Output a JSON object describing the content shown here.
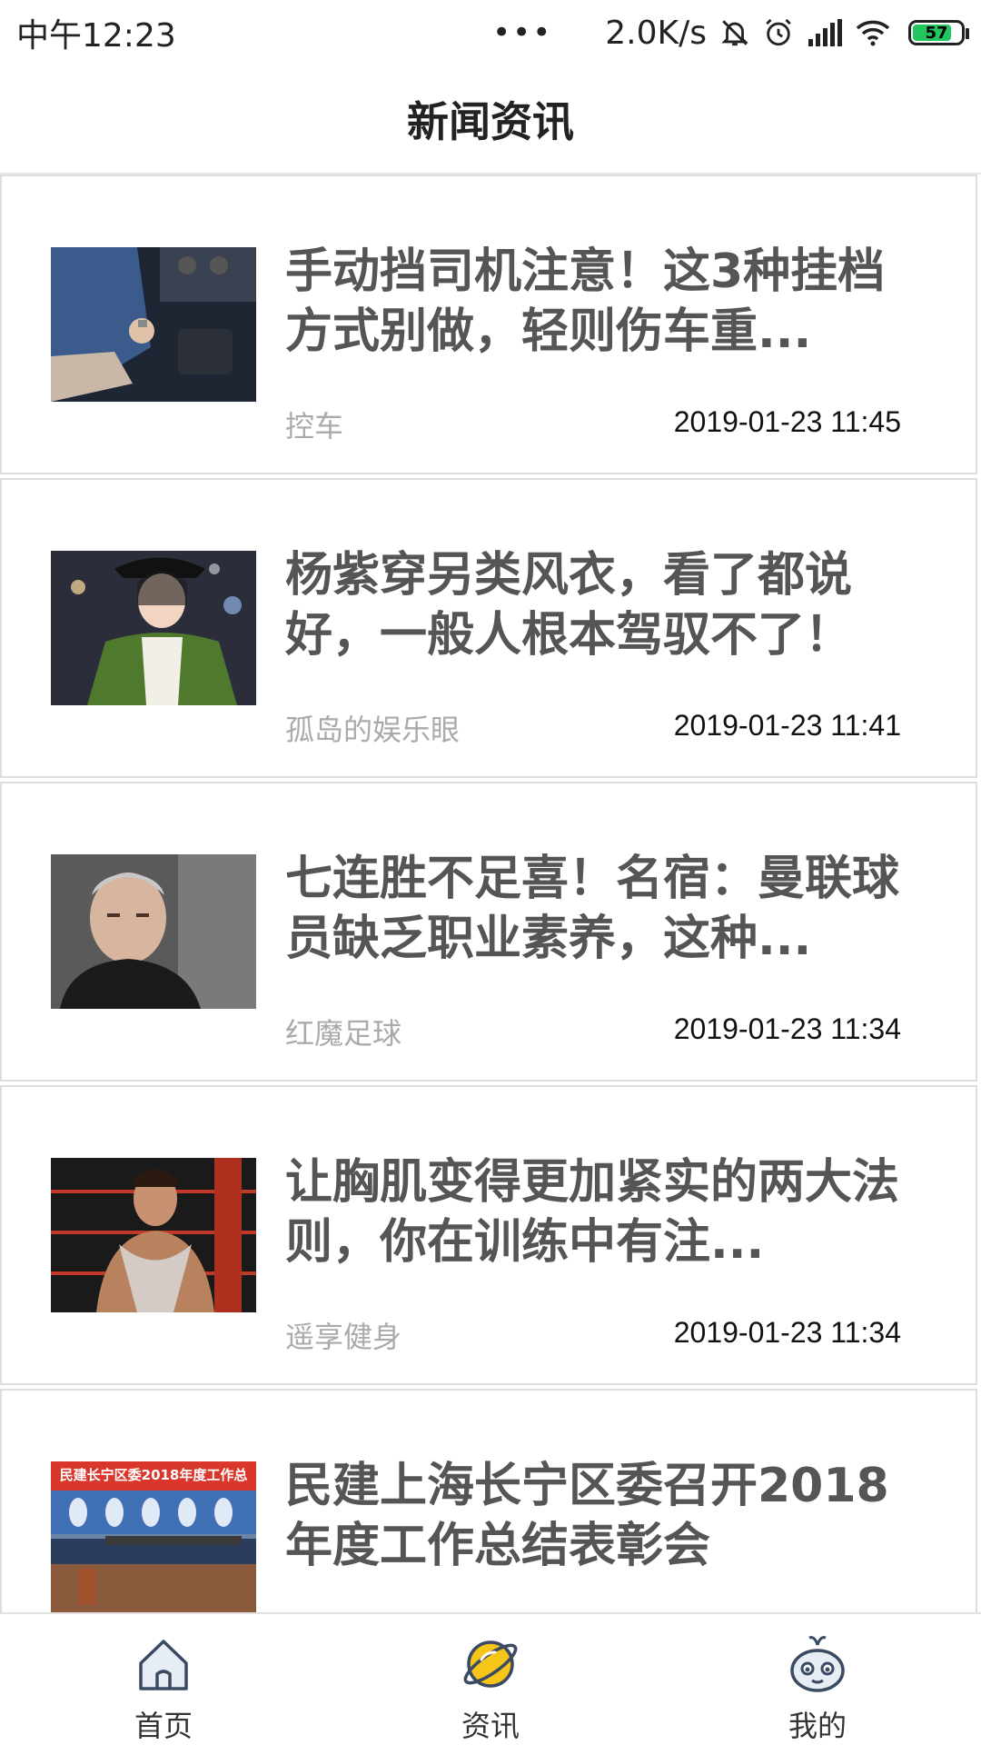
{
  "status_bar": {
    "time": "中午12:23",
    "dots": "•••",
    "speed": "2.0K/s",
    "battery": "57",
    "icons": [
      "bell-muted-icon",
      "alarm-icon",
      "signal-icon",
      "wifi-icon",
      "battery-icon"
    ]
  },
  "header": {
    "title": "新闻资讯"
  },
  "news": [
    {
      "title": "手动挡司机注意！这3种挂档方式别做，轻则伤车重...",
      "source": "控车",
      "time": "2019-01-23 11:45"
    },
    {
      "title": "杨紫穿另类风衣，看了都说好，一般人根本驾驭不了！",
      "source": "孤岛的娱乐眼",
      "time": "2019-01-23 11:41"
    },
    {
      "title": "七连胜不足喜！名宿：曼联球员缺乏职业素养，这种...",
      "source": "红魔足球",
      "time": "2019-01-23 11:34"
    },
    {
      "title": "让胸肌变得更加紧实的两大法则，你在训练中有注...",
      "source": "遥享健身",
      "time": "2019-01-23 11:34"
    },
    {
      "title": "民建上海长宁区委召开2018年度工作总结表彰会",
      "source": "",
      "time": ""
    }
  ],
  "thumb5_banner": "民建长宁区委2018年度工作总",
  "bottom_nav": [
    {
      "label": "首页",
      "icon": "home-icon"
    },
    {
      "label": "资讯",
      "icon": "planet-icon"
    },
    {
      "label": "我的",
      "icon": "mascot-face-icon"
    }
  ],
  "colors": {
    "accent": "#f5c518",
    "title": "#555555",
    "source": "#aaaaaa"
  }
}
